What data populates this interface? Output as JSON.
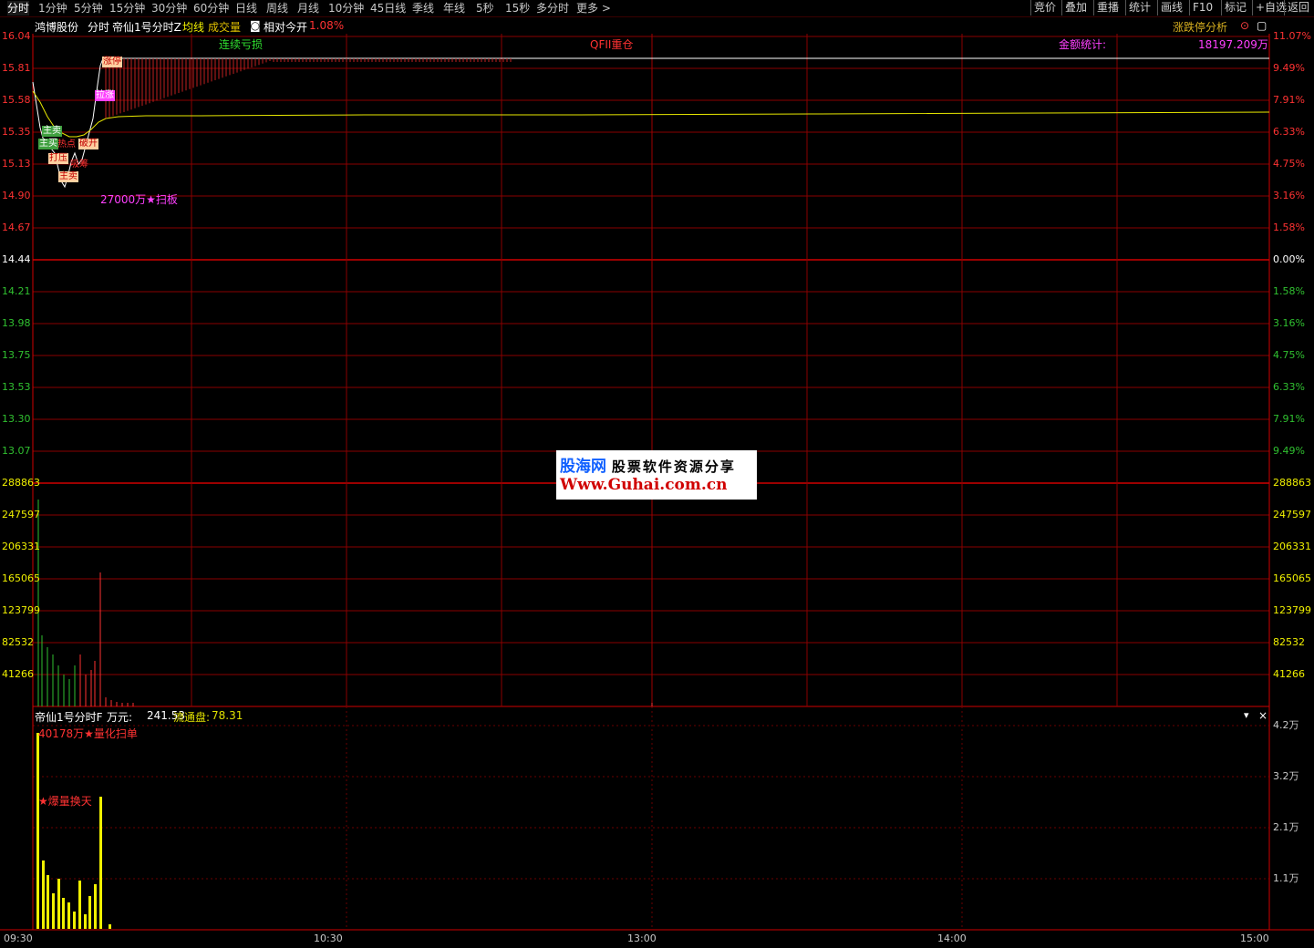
{
  "toolbar": {
    "periods": [
      "分时",
      "1分钟",
      "5分钟",
      "15分钟",
      "30分钟",
      "60分钟",
      "日线",
      "周线",
      "月线",
      "10分钟",
      "45日线",
      "季线",
      "年线",
      "5秒",
      "15秒",
      "多分时",
      "更多 >"
    ],
    "right_buttons": [
      "竞价",
      "叠加",
      "重播",
      "统计",
      "画线",
      "F10",
      "标记",
      "+自选",
      "返回"
    ]
  },
  "infobar": {
    "stock_name": "鸿博股份",
    "mode": "分时",
    "indicator": "帝仙1号分时Z",
    "avg_label": "均线",
    "vol_label": "成交量",
    "relative_label": "相对今开",
    "relative_value": "1.08%",
    "analysis_label": "涨跌停分析"
  },
  "price_axis": {
    "left": [
      "16.04",
      "15.81",
      "15.58",
      "15.35",
      "15.13",
      "14.90",
      "14.67",
      "14.44",
      "14.21",
      "13.98",
      "13.75",
      "13.53",
      "13.30",
      "13.07"
    ],
    "right": [
      "11.07%",
      "9.49%",
      "7.91%",
      "6.33%",
      "4.75%",
      "3.16%",
      "1.58%",
      "0.00%",
      "1.58%",
      "3.16%",
      "4.75%",
      "6.33%",
      "7.91%",
      "9.49%"
    ]
  },
  "volume_axis": {
    "left": [
      "288863",
      "247597",
      "206331",
      "165065",
      "123799",
      "82532",
      "41266"
    ],
    "right": [
      "288863",
      "247597",
      "206331",
      "165065",
      "123799",
      "82532",
      "41266"
    ]
  },
  "annotations": {
    "continuous_loss": "连续亏损",
    "qfii": "QFII重仓",
    "amount_stat_label": "金额统计:",
    "amount_stat_value": "18197.209万",
    "sweep": "27000万★扫板",
    "limit_tag": "涨停",
    "tag_pink": "拉涨",
    "main_sell": "主卖",
    "main_buy": "主买",
    "break_open": "破开",
    "pull": "打压",
    "suck": "吸筹",
    "hot": "热点"
  },
  "indicator_panel": {
    "name": "帝仙1号分时F",
    "unit": "万元:",
    "value": "241.53",
    "float_label": "流通盘:",
    "float_value": "78.31",
    "tag_quant": "40178万★量化扫单",
    "tag_explode": "★爆量换天",
    "axis": [
      "4.2万",
      "3.2万",
      "2.1万",
      "1.1万"
    ]
  },
  "watermark": {
    "brand": "股海网",
    "slogan": "股票软件资源分享",
    "url": "Www.Guhai.com.cn"
  },
  "time_axis": [
    "09:30",
    "10:30",
    "13:00",
    "14:00",
    "15:00"
  ],
  "colors": {
    "grid_red": "#8a0000",
    "price_line": "#ffffff",
    "avg_line": "#e8e800",
    "vol_up": "#ff3232",
    "vol_down": "#30c030",
    "indicator_bar": "#f0f000"
  }
}
